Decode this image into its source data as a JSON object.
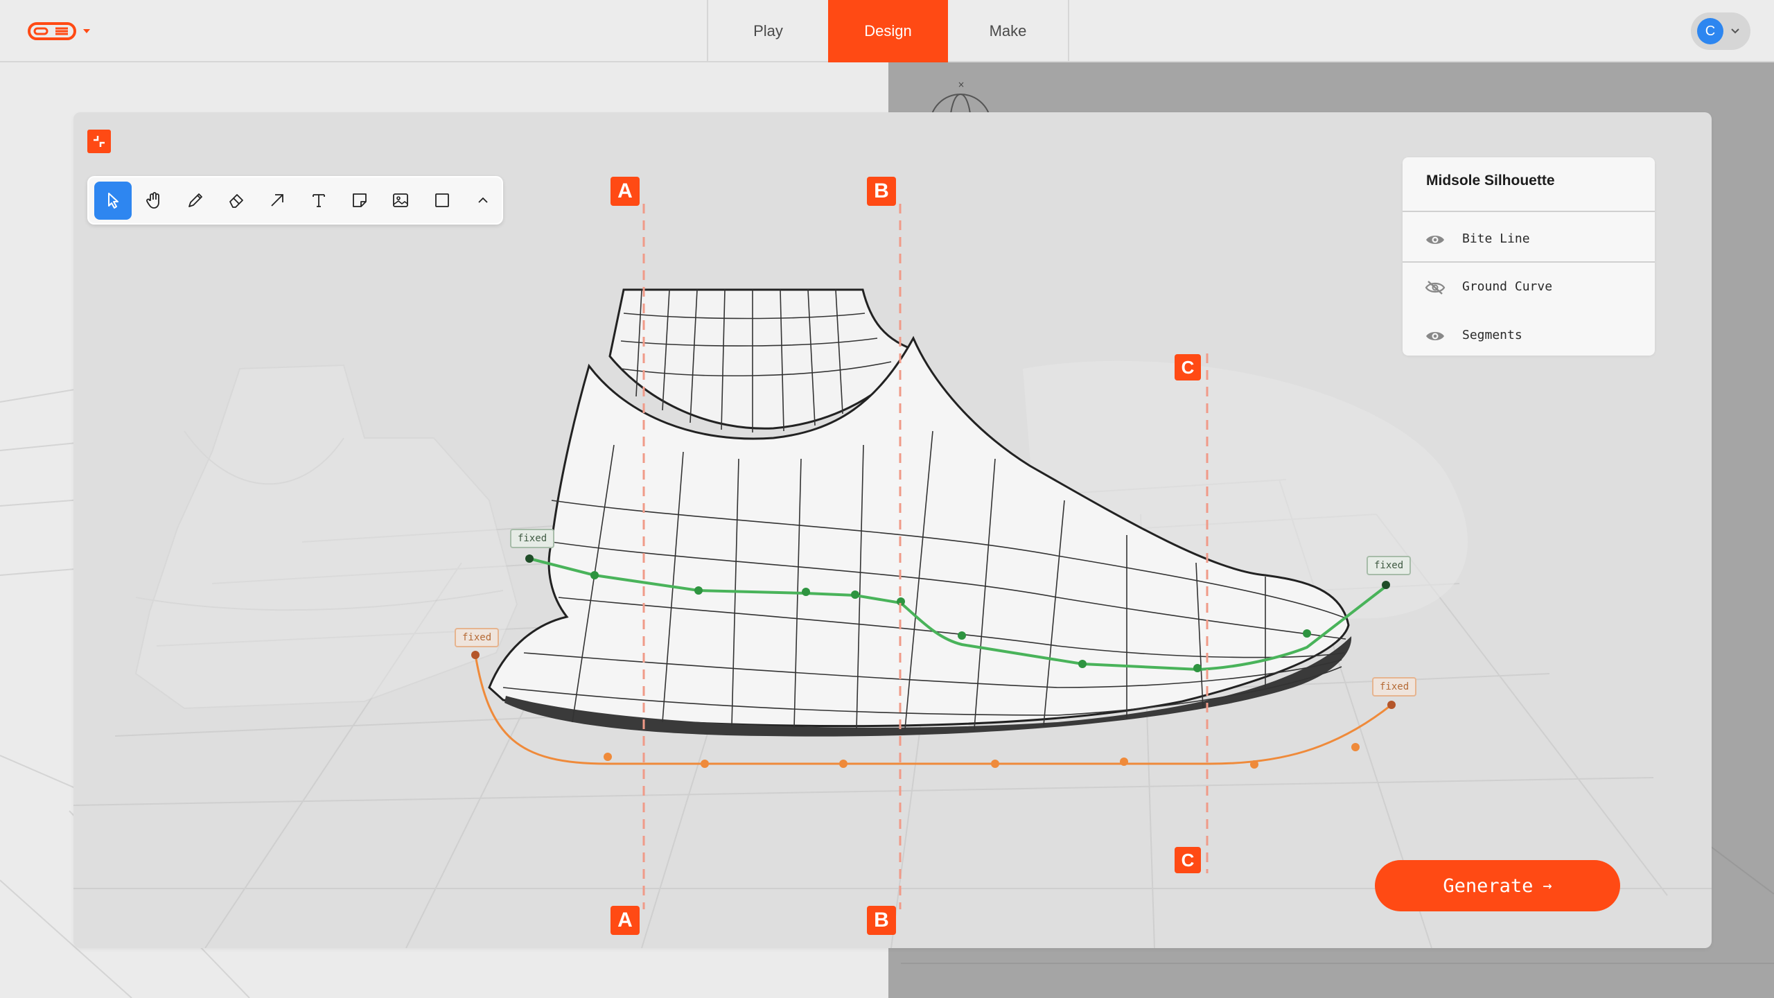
{
  "app": {
    "colors": {
      "accent": "#ff4a14",
      "active_tool": "#2e86f0",
      "bite_line": "#49b35a",
      "ground_curve": "#ef8a3a"
    }
  },
  "header": {
    "logo_icon": "os-logo-icon",
    "tabs": [
      {
        "label": "Play",
        "active": false
      },
      {
        "label": "Design",
        "active": true
      },
      {
        "label": "Make",
        "active": false
      }
    ],
    "user": {
      "initial": "C"
    }
  },
  "toolbar": {
    "tools": [
      {
        "name": "select-tool",
        "icon": "pointer-icon",
        "active": true
      },
      {
        "name": "hand-tool",
        "icon": "hand-icon",
        "active": false
      },
      {
        "name": "pencil-tool",
        "icon": "pencil-icon",
        "active": false
      },
      {
        "name": "eraser-tool",
        "icon": "eraser-icon",
        "active": false
      },
      {
        "name": "arrow-tool",
        "icon": "arrow-icon",
        "active": false
      },
      {
        "name": "text-tool",
        "icon": "text-icon",
        "active": false
      },
      {
        "name": "sticky-note-tool",
        "icon": "sticky-note-icon",
        "active": false
      },
      {
        "name": "image-tool",
        "icon": "image-icon",
        "active": false
      },
      {
        "name": "rectangle-tool",
        "icon": "rectangle-icon",
        "active": false
      },
      {
        "name": "collapse-toolbar",
        "icon": "chevron-up-icon",
        "active": false
      }
    ]
  },
  "layers": {
    "title": "Midsole Silhouette",
    "items": [
      {
        "label": "Bite Line",
        "visible": true
      },
      {
        "label": "Ground Curve",
        "visible": false
      },
      {
        "label": "Segments",
        "visible": true
      }
    ]
  },
  "sections": {
    "a": "A",
    "b": "B",
    "c": "C"
  },
  "tags": {
    "fixed": "fixed"
  },
  "generate": {
    "label": "Generate",
    "arrow": "→"
  }
}
